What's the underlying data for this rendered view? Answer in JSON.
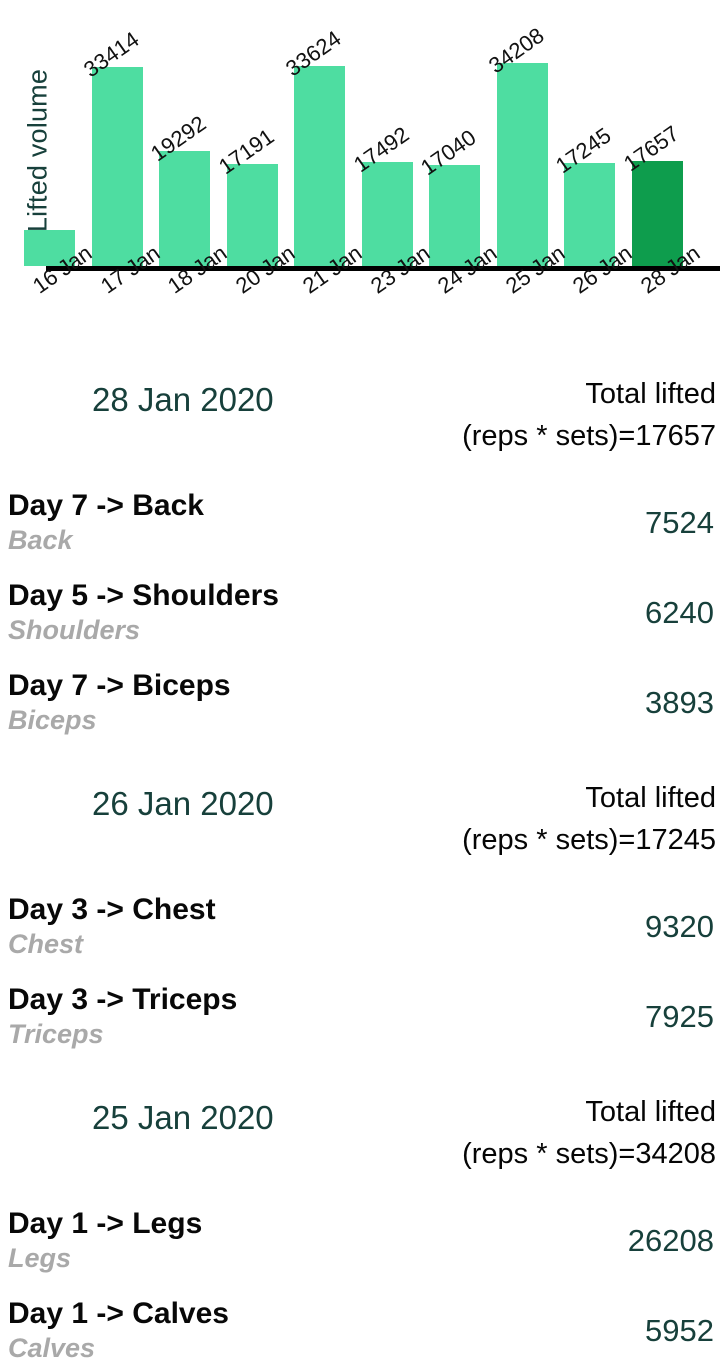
{
  "chart_data": {
    "type": "bar",
    "title": "",
    "xlabel": "",
    "ylabel": "Lifted volume",
    "grid": false,
    "legend": "none",
    "categories": [
      "16 Jan",
      "17 Jan",
      "18 Jan",
      "20 Jan",
      "21 Jan",
      "23 Jan",
      "24 Jan",
      "25 Jan",
      "26 Jan",
      "28 Jan"
    ],
    "values": [
      null,
      33414,
      19292,
      17191,
      33624,
      17492,
      17040,
      34208,
      17245,
      17657
    ],
    "value_labels": [
      "",
      "33414",
      "19292",
      "17191",
      "33624",
      "17492",
      "17040",
      "34208",
      "17245",
      "17657"
    ],
    "ylim": [
      0,
      36000
    ],
    "bar_color": "#4EDDA1",
    "highlight_color": "#0E9D4D",
    "highlighted_index": 9,
    "axis_color": "#000000",
    "ylabel_color": "#17403B",
    "note": "leftmost bar and its tick label are clipped at the left edge of the viewport"
  },
  "bars": [
    {
      "label": "16 Jan",
      "value_label": "",
      "value": 6000,
      "highlight": false,
      "clipped": true
    },
    {
      "label": "17 Jan",
      "value_label": "33414",
      "value": 33414,
      "highlight": false,
      "clipped": false
    },
    {
      "label": "18 Jan",
      "value_label": "19292",
      "value": 19292,
      "highlight": false,
      "clipped": false
    },
    {
      "label": "20 Jan",
      "value_label": "17191",
      "value": 17191,
      "highlight": false,
      "clipped": false
    },
    {
      "label": "21 Jan",
      "value_label": "33624",
      "value": 33624,
      "highlight": false,
      "clipped": false
    },
    {
      "label": "23 Jan",
      "value_label": "17492",
      "value": 17492,
      "highlight": false,
      "clipped": false
    },
    {
      "label": "24 Jan",
      "value_label": "17040",
      "value": 17040,
      "highlight": false,
      "clipped": false
    },
    {
      "label": "25 Jan",
      "value_label": "34208",
      "value": 34208,
      "highlight": false,
      "clipped": false
    },
    {
      "label": "26 Jan",
      "value_label": "17245",
      "value": 17245,
      "highlight": false,
      "clipped": false
    },
    {
      "label": "28 Jan",
      "value_label": "17657",
      "value": 17657,
      "highlight": true,
      "clipped": false
    }
  ],
  "days": [
    {
      "date": "28 Jan 2020",
      "total_line1": "Total lifted",
      "total_line2": "(reps * sets)=17657",
      "entries": [
        {
          "title": "Day 7 -> Back",
          "subtitle": "Back",
          "value": "7524"
        },
        {
          "title": "Day 5 -> Shoulders",
          "subtitle": "Shoulders",
          "value": "6240"
        },
        {
          "title": "Day 7 -> Biceps",
          "subtitle": "Biceps",
          "value": "3893"
        }
      ]
    },
    {
      "date": "26 Jan 2020",
      "total_line1": "Total lifted",
      "total_line2": "(reps * sets)=17245",
      "entries": [
        {
          "title": "Day 3 -> Chest",
          "subtitle": "Chest",
          "value": "9320"
        },
        {
          "title": "Day 3 -> Triceps",
          "subtitle": "Triceps",
          "value": "7925"
        }
      ]
    },
    {
      "date": "25 Jan 2020",
      "total_line1": "Total lifted",
      "total_line2": "(reps * sets)=34208",
      "entries": [
        {
          "title": "Day 1 -> Legs",
          "subtitle": "Legs",
          "value": "26208"
        },
        {
          "title": "Day 1 -> Calves",
          "subtitle": "Calves",
          "value": "5952"
        }
      ]
    }
  ]
}
